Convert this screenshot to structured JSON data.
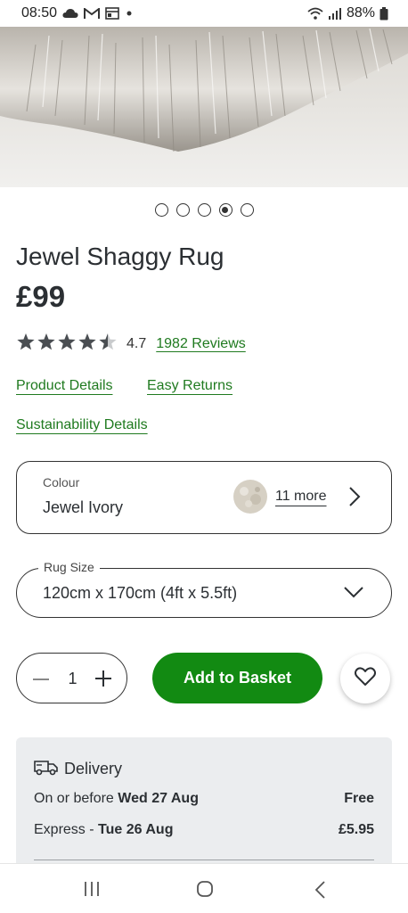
{
  "status_bar": {
    "time": "08:50",
    "battery": "88%",
    "icons": [
      "cloud-icon",
      "gmail-icon",
      "news-icon",
      "dot-icon",
      "wifi-icon",
      "signal-icon",
      "battery-icon"
    ]
  },
  "gallery": {
    "image": "shaggy-rug-closeup",
    "total_slides": 5,
    "active_index": 3
  },
  "product": {
    "title": "Jewel Shaggy Rug",
    "price": "£99",
    "rating_value": "4.7",
    "rating": 4.5,
    "reviews_link": "1982 Reviews"
  },
  "links": {
    "product_details": "Product Details",
    "easy_returns": "Easy Returns",
    "sustainability": "Sustainability Details"
  },
  "colour": {
    "label": "Colour",
    "value": "Jewel Ivory",
    "more": "11 more"
  },
  "size": {
    "label": "Rug Size",
    "value": "120cm x 170cm (4ft x 5.5ft)"
  },
  "purchase": {
    "quantity": "1",
    "add_button": "Add to Basket"
  },
  "delivery": {
    "title": "Delivery",
    "standard_label": "On or before ",
    "standard_date": "Wed 27 Aug",
    "standard_price": "Free",
    "express_label": "Express - ",
    "express_date": "Tue 26 Aug",
    "express_price": "£5.95"
  },
  "colors": {
    "accent_green": "#128a12",
    "link_green": "#1f7a1f",
    "text_dark": "#2b2f33",
    "panel_bg": "#ebedef"
  }
}
